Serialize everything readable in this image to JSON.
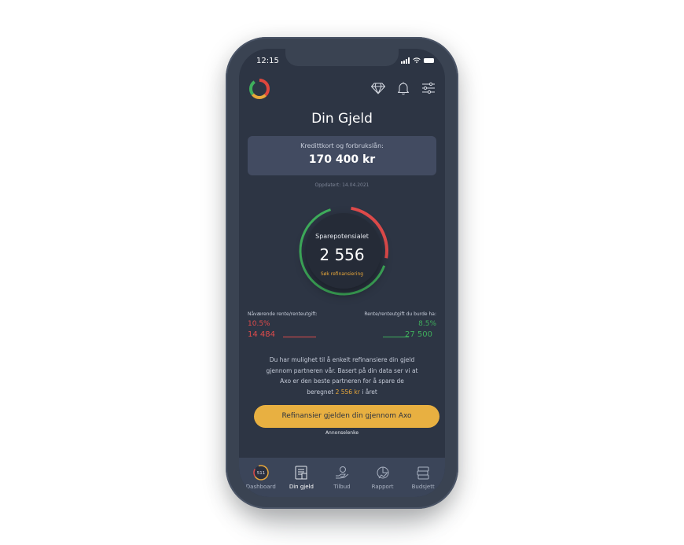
{
  "status": {
    "time": "12:15"
  },
  "header": {
    "title": "Din Gjeld",
    "icons": [
      "app-logo-ring",
      "diamond-icon",
      "bell-icon",
      "sliders-icon"
    ]
  },
  "debt_card": {
    "label": "Kredittkort og forbrukslån:",
    "value": "170 400 kr"
  },
  "updated": "Oppdatert: 14.04.2021",
  "gauge": {
    "label": "Sparepotensialet",
    "value": "2 556",
    "cta": "Søk refinansiering",
    "colors": {
      "current": "#e04b4b",
      "potential": "#3fae5c"
    }
  },
  "rates": {
    "current_label": "Nåværende rente/renteutgift:",
    "current_rate": "10.5%",
    "current_amount": "14 484",
    "target_label": "Rente/renteutgift du burde ha:",
    "target_rate": "8.5%",
    "target_amount": "27 500"
  },
  "info": {
    "line1": "Du har mulighet til å enkelt refinansiere din gjeld",
    "line2": "gjennom partneren vår. Basert på din data ser vi at",
    "line3": "Axo er den beste partneren for å spare de",
    "line4_pre": "beregnet",
    "line4_highlight": "2 556 kr",
    "line4_post": "i året"
  },
  "cta": {
    "label": "Refinansier gjelden din gjennom Axo",
    "ad_label": "Annonselenke"
  },
  "tabs": [
    {
      "label": "Dashboard",
      "icon": "score-ring-icon",
      "badge": "511",
      "active": false
    },
    {
      "label": "Din gjeld",
      "icon": "debt-document-icon",
      "active": true
    },
    {
      "label": "Tilbud",
      "icon": "offer-hand-icon",
      "active": false
    },
    {
      "label": "Rapport",
      "icon": "report-chart-icon",
      "active": false
    },
    {
      "label": "Budsjett",
      "icon": "budget-stack-icon",
      "active": false
    }
  ],
  "colors": {
    "accent": "#e8b041",
    "background": "#2d3544",
    "positive": "#3fae5c",
    "negative": "#e04b4b"
  }
}
